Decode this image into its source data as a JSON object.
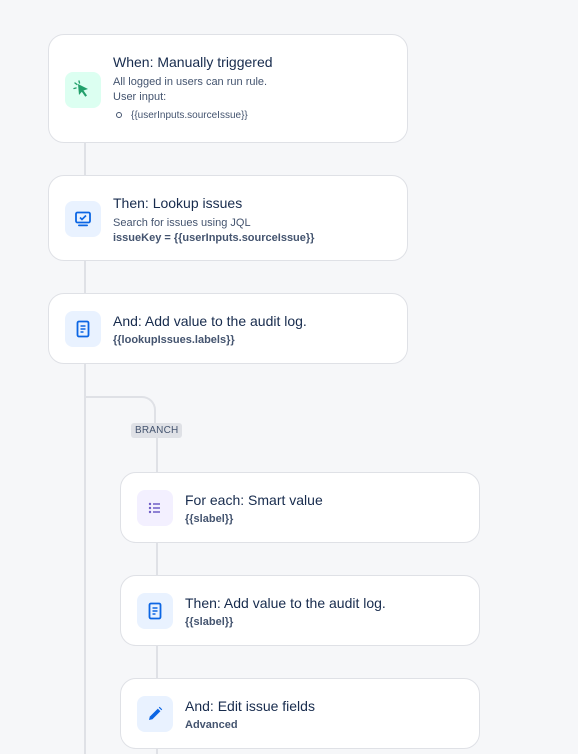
{
  "steps": [
    {
      "title": "When: Manually triggered",
      "lines": [
        "All logged in users can run rule.",
        "User input:"
      ],
      "bullet": "{{userInputs.sourceIssue}}",
      "icon": "cursor-click-icon",
      "color": "#22a06b"
    },
    {
      "title": "Then: Lookup issues",
      "lines": [
        "Search for issues using JQL"
      ],
      "detail": "issueKey = {{userInputs.sourceIssue}}",
      "icon": "monitor-check-icon",
      "color": "#0c66e4"
    },
    {
      "title": "And: Add value to the audit log.",
      "detail": "{{lookupIssues.labels}}",
      "icon": "document-icon",
      "color": "#0c66e4"
    }
  ],
  "branch": {
    "label": "BRANCH",
    "steps": [
      {
        "title": "For each: Smart value",
        "detail": "{{slabel}}",
        "icon": "list-icon",
        "color": "#6e5dc6"
      },
      {
        "title": "Then: Add value to the audit log.",
        "detail": "{{slabel}}",
        "icon": "document-icon",
        "color": "#0c66e4"
      },
      {
        "title": "And: Edit issue fields",
        "detail": "Advanced",
        "icon": "pencil-icon",
        "color": "#0c66e4"
      }
    ]
  }
}
